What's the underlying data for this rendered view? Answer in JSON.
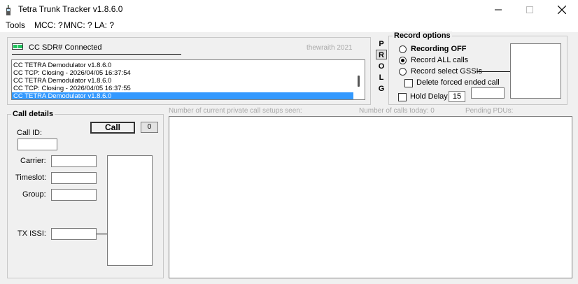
{
  "window": {
    "title": "Tetra Trunk Tracker v1.8.6.0"
  },
  "menubar": {
    "tools": "Tools",
    "mcc": "MCC: ?",
    "mnc": "MNC: ?",
    "la": "LA: ?"
  },
  "status_panel": {
    "connection_label": "CC SDR# Connected",
    "watermark": "thewraith 2021",
    "log_lines": [
      "CC TETRA Demodulator v1.8.6.0",
      "CC TCP: Closing - 2026/04/05 16:37:54",
      "CC TETRA Demodulator v1.8.6.0",
      "CC TCP: Closing - 2026/04/05 16:37:55",
      "CC TETRA Demodulator v1.8.6.0"
    ],
    "selected_index": 4
  },
  "plog_buttons": [
    "P",
    "R",
    "O",
    "L",
    "G"
  ],
  "record_options": {
    "title": "Record options",
    "recording_off": "Recording OFF",
    "record_all": "Record ALL calls",
    "record_select": "Record select GSSIs",
    "delete_forced": "Delete forced ended call",
    "hold_delay_label": "Hold Delay",
    "hold_delay_value": "15",
    "selected": "record_all"
  },
  "call_details": {
    "title": "Call details",
    "call_button": "Call",
    "call_count": "0",
    "call_id_label": "Call ID:",
    "carrier_label": "Carrier:",
    "timeslot_label": "Timeslot:",
    "group_label": "Group:",
    "tx_issi_label": "TX ISSI:"
  },
  "stats": {
    "private_setups": "Number of current private call setups seen:",
    "calls_today": "Number of calls today: 0",
    "pending_pdus": "Pending PDUs:"
  },
  "colors": {
    "selection": "#3399ff",
    "led_green": "#22c55e"
  }
}
